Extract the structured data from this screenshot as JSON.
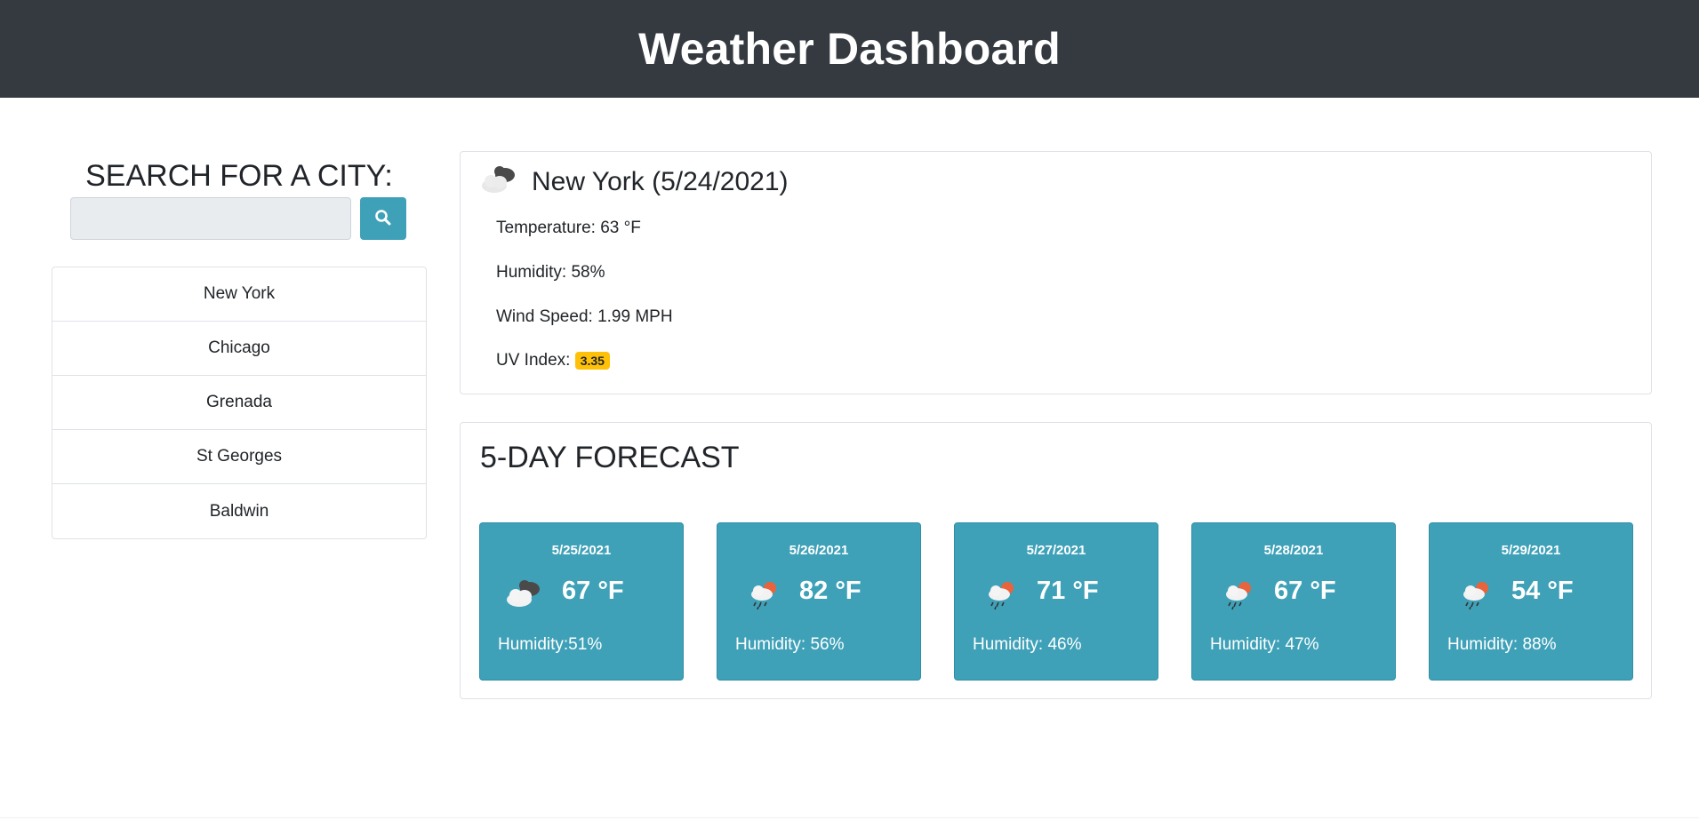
{
  "header": {
    "title": "Weather Dashboard"
  },
  "search": {
    "heading": "SEARCH FOR A CITY:",
    "input_value": "",
    "placeholder": "",
    "button_icon": "search-icon"
  },
  "cities": [
    "New York",
    "Chicago",
    "Grenada",
    "St Georges",
    "Baldwin"
  ],
  "current": {
    "title": "New York (5/24/2021)",
    "icon": "cloudy-icon",
    "temperature": "Temperature: 63 °F",
    "humidity": "Humidity: 58%",
    "wind": "Wind Speed: 1.99 MPH",
    "uv_label": "UV Index:",
    "uv_value": "3.35",
    "uv_color": "#ffc107"
  },
  "forecast": {
    "heading": "5-DAY FORECAST",
    "card_color": "#3fa1b8",
    "days": [
      {
        "date": "5/25/2021",
        "icon": "cloudy-icon",
        "temp": "67 °F",
        "humidity": "Humidity:51%"
      },
      {
        "date": "5/26/2021",
        "icon": "sun-rain-icon",
        "temp": "82 °F",
        "humidity": "Humidity: 56%"
      },
      {
        "date": "5/27/2021",
        "icon": "sun-rain-icon",
        "temp": "71 °F",
        "humidity": "Humidity: 46%"
      },
      {
        "date": "5/28/2021",
        "icon": "sun-rain-icon",
        "temp": "67 °F",
        "humidity": "Humidity: 47%"
      },
      {
        "date": "5/29/2021",
        "icon": "sun-rain-icon",
        "temp": "54 °F",
        "humidity": "Humidity: 88%"
      }
    ]
  }
}
